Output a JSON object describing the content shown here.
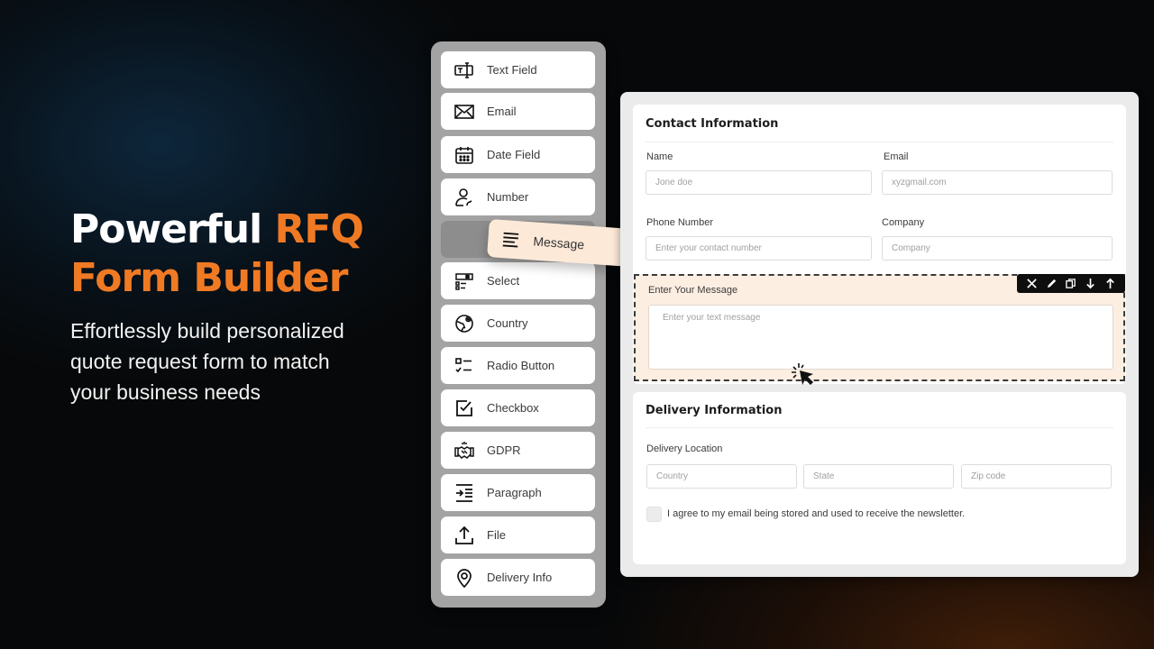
{
  "hero": {
    "title_line1_white": "Powerful ",
    "title_line1_accent": "RFQ",
    "title_line2_accent": "Form Builder",
    "subtitle_lines": [
      "Effortlessly build personalized",
      "quote request form to match",
      "your business needs"
    ],
    "accent_color": "#f07a24"
  },
  "palette": {
    "items": [
      {
        "label": "Text Field",
        "icon": "text-field-icon"
      },
      {
        "label": "Email",
        "icon": "envelope-icon"
      },
      {
        "label": "Date Field",
        "icon": "calendar-icon"
      },
      {
        "label": "Number",
        "icon": "user-phone-icon"
      },
      {
        "label": "Select",
        "icon": "select-list-icon"
      },
      {
        "label": "Country",
        "icon": "globe-pin-icon"
      },
      {
        "label": "Radio Button",
        "icon": "checklist-icon"
      },
      {
        "label": "Checkbox",
        "icon": "checkbox-icon"
      },
      {
        "label": "GDPR",
        "icon": "handshake-icon"
      },
      {
        "label": "Paragraph",
        "icon": "indent-icon"
      },
      {
        "label": "File",
        "icon": "upload-icon"
      },
      {
        "label": "Delivery Info",
        "icon": "location-pin-icon"
      }
    ],
    "dragged_item": {
      "label": "Message",
      "icon": "lines-icon"
    }
  },
  "form": {
    "contact": {
      "title": "Contact Information",
      "name_label": "Name",
      "name_placeholder": "Jone doe",
      "email_label": "Email",
      "email_placeholder": "xyzgmail.com",
      "phone_label": "Phone Number",
      "phone_placeholder": "Enter your contact number",
      "company_label": "Company",
      "company_placeholder": "Company"
    },
    "message": {
      "label": "Enter Your Message",
      "placeholder": "Enter your text message",
      "toolbar": [
        "close-icon",
        "edit-icon",
        "duplicate-icon",
        "move-down-icon",
        "move-up-icon"
      ]
    },
    "delivery": {
      "title": "Delivery Information",
      "location_label": "Delivery Location",
      "country_placeholder": "Country",
      "state_placeholder": "State",
      "zip_placeholder": "Zip code",
      "consent_text": "I agree to my email being stored and used to receive the newsletter."
    }
  }
}
